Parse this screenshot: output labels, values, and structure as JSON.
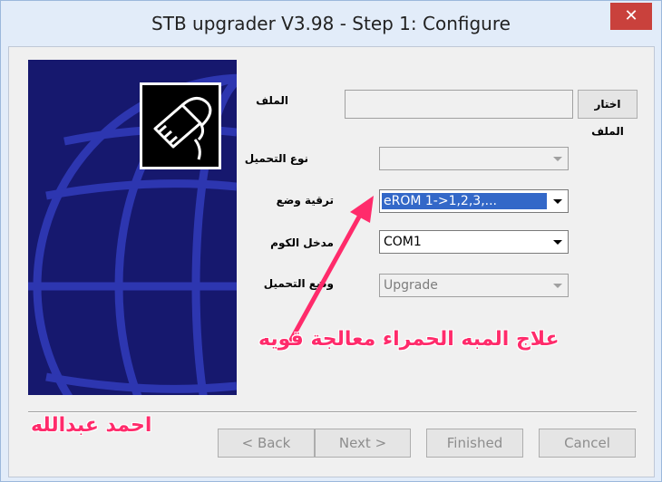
{
  "window": {
    "title": "STB upgrader V3.98 - Step 1: Configure",
    "close_label": "✕"
  },
  "form": {
    "file_label": "الملف",
    "file_value": "",
    "browse_label": "اختار الملف",
    "load_type_label": "نوع التحميل",
    "load_type_value": "",
    "upgrade_mode_label": "ترقية وضع",
    "upgrade_mode_value": "eROM  1->1,2,3,...",
    "com_port_label": "مدخل الكوم",
    "com_port_value": "COM1",
    "load_mode_label": "وضع التحميل",
    "load_mode_value": "Upgrade"
  },
  "buttons": {
    "back": "< Back",
    "next": "Next >",
    "finished": "Finished",
    "cancel": "Cancel"
  },
  "annotations": {
    "callout": "علاج المبه الحمراء معالجة قويه",
    "author": "احمد عبدالله",
    "accent": "#ff2b6b"
  }
}
